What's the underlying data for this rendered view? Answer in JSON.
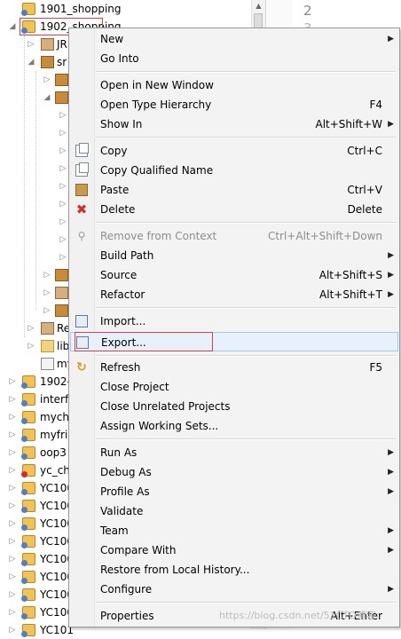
{
  "tree": {
    "items": [
      {
        "label": "1901_shopping",
        "icon": "project-icon"
      },
      {
        "label": "1902_shopping",
        "icon": "project-icon"
      },
      {
        "label": "JR",
        "icon": "library-icon"
      },
      {
        "label": "sr",
        "icon": "source-folder-icon"
      },
      {
        "label": "Re",
        "icon": "library-icon"
      },
      {
        "label": "lib",
        "icon": "folder-icon"
      },
      {
        "label": "my",
        "icon": "file-icon"
      },
      {
        "label": "1902-",
        "icon": "project-icon"
      },
      {
        "label": "interf",
        "icon": "project-icon"
      },
      {
        "label": "mychr",
        "icon": "project-icon"
      },
      {
        "label": "myfrie",
        "icon": "project-icon"
      },
      {
        "label": "oop3",
        "icon": "project-icon"
      },
      {
        "label": "yc_chu",
        "icon": "project-error-icon"
      },
      {
        "label": "YC100",
        "icon": "project-icon"
      },
      {
        "label": "YC100",
        "icon": "project-icon"
      },
      {
        "label": "YC100",
        "icon": "project-icon"
      },
      {
        "label": "YC100",
        "icon": "project-icon"
      },
      {
        "label": "YC100",
        "icon": "project-icon"
      },
      {
        "label": "YC100",
        "icon": "project-icon"
      },
      {
        "label": "YC100",
        "icon": "project-icon"
      },
      {
        "label": "YC100",
        "icon": "project-icon"
      },
      {
        "label": "YC101",
        "icon": "project-icon"
      }
    ]
  },
  "editor": {
    "line_number": "2",
    "line_number_next": "3"
  },
  "menu": {
    "new": {
      "label": "New"
    },
    "go_into": {
      "label": "Go Into"
    },
    "open_new_window": {
      "label": "Open in New Window"
    },
    "open_type_hierarchy": {
      "label": "Open Type Hierarchy",
      "shortcut": "F4"
    },
    "show_in": {
      "label": "Show In",
      "shortcut": "Alt+Shift+W"
    },
    "copy": {
      "label": "Copy",
      "shortcut": "Ctrl+C"
    },
    "copy_qualified": {
      "label": "Copy Qualified Name"
    },
    "paste": {
      "label": "Paste",
      "shortcut": "Ctrl+V"
    },
    "delete": {
      "label": "Delete",
      "shortcut": "Delete"
    },
    "remove_context": {
      "label": "Remove from Context",
      "shortcut": "Ctrl+Alt+Shift+Down"
    },
    "build_path": {
      "label": "Build Path"
    },
    "source": {
      "label": "Source",
      "shortcut": "Alt+Shift+S"
    },
    "refactor": {
      "label": "Refactor",
      "shortcut": "Alt+Shift+T"
    },
    "import": {
      "label": "Import..."
    },
    "export": {
      "label": "Export..."
    },
    "refresh": {
      "label": "Refresh",
      "shortcut": "F5"
    },
    "close_project": {
      "label": "Close Project"
    },
    "close_unrelated": {
      "label": "Close Unrelated Projects"
    },
    "assign_working_sets": {
      "label": "Assign Working Sets..."
    },
    "run_as": {
      "label": "Run As"
    },
    "debug_as": {
      "label": "Debug As"
    },
    "profile_as": {
      "label": "Profile As"
    },
    "validate": {
      "label": "Validate"
    },
    "team": {
      "label": "Team"
    },
    "compare_with": {
      "label": "Compare With"
    },
    "restore_history": {
      "label": "Restore from Local History..."
    },
    "configure": {
      "label": "Configure"
    },
    "properties": {
      "label": "Properties",
      "shortcut": "Alt+Enter"
    }
  },
  "watermark": "https://blog.csdn.net/51CTO博客"
}
